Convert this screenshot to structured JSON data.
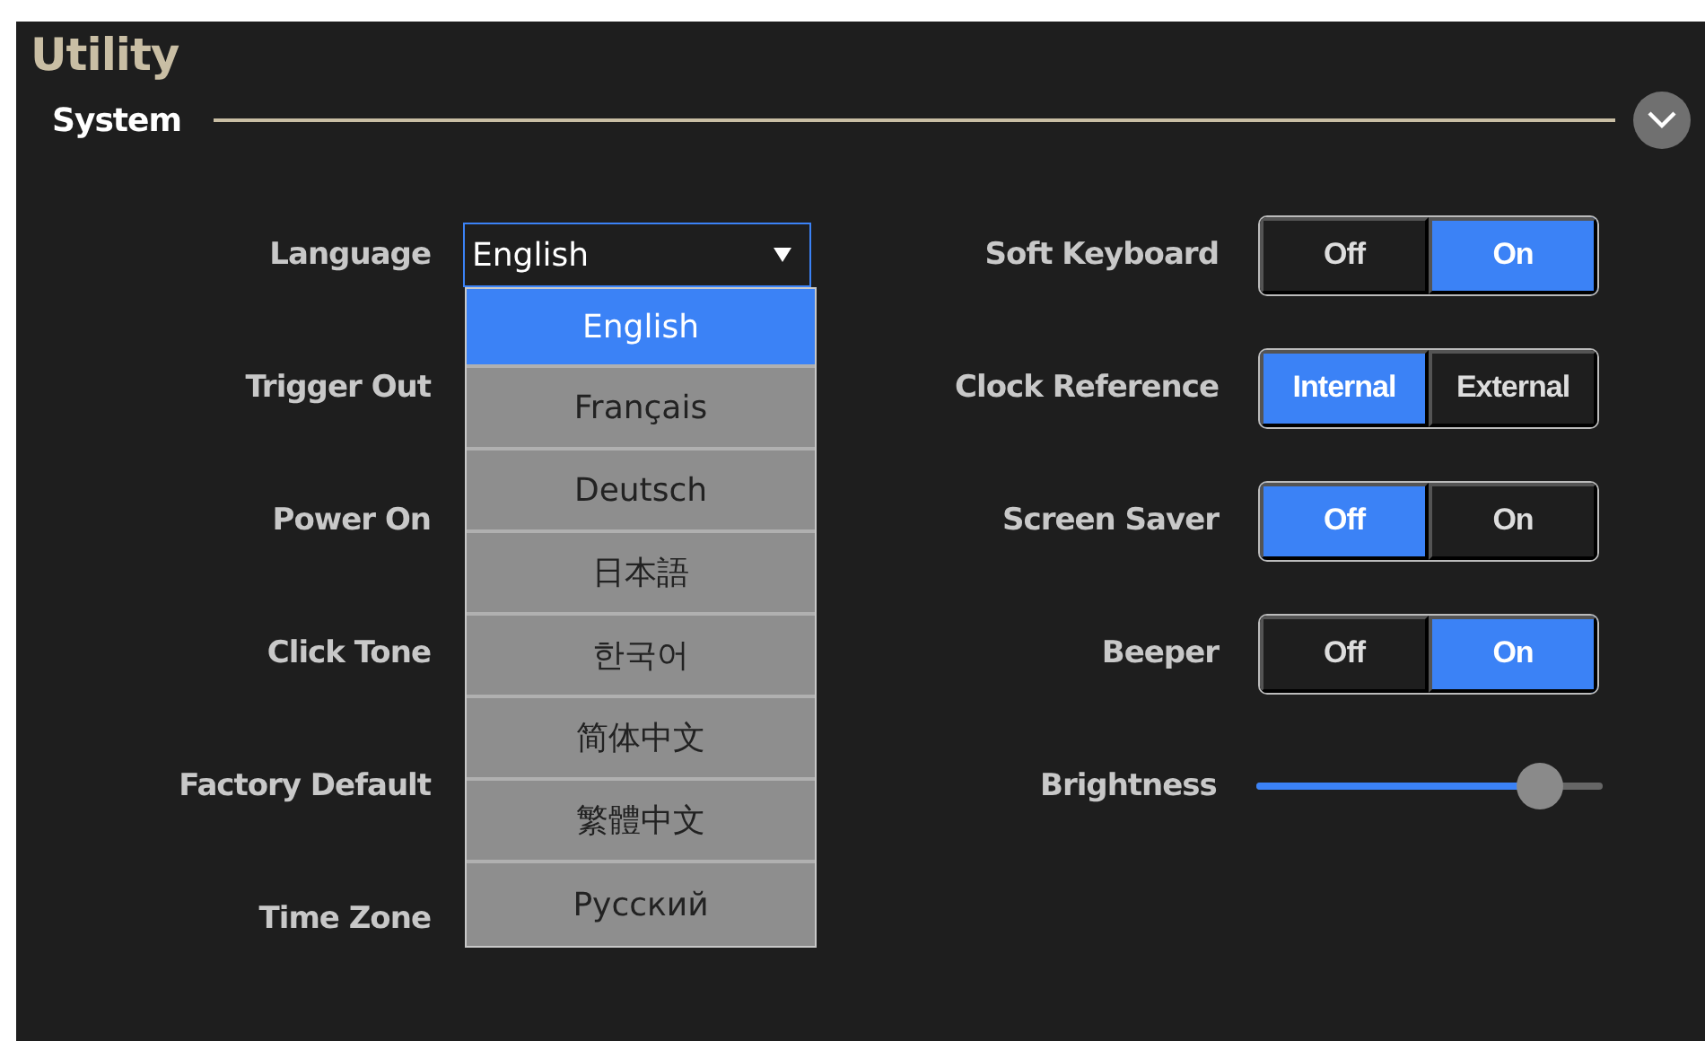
{
  "title": "Utility",
  "section": {
    "title": "System"
  },
  "left_settings": [
    {
      "label": "Language",
      "kind": "dropdown",
      "value": "English",
      "open": true,
      "options": [
        {
          "label": "English",
          "selected": true
        },
        {
          "label": "Français",
          "selected": false
        },
        {
          "label": "Deutsch",
          "selected": false
        },
        {
          "label": "日本語",
          "selected": false
        },
        {
          "label": "한국어",
          "selected": false
        },
        {
          "label": "简体中文",
          "selected": false
        },
        {
          "label": "繁體中文",
          "selected": false
        },
        {
          "label": "Русский",
          "selected": false
        }
      ]
    },
    {
      "label": "Trigger Out",
      "kind": "covered"
    },
    {
      "label": "Power On",
      "kind": "covered"
    },
    {
      "label": "Click Tone",
      "kind": "covered"
    },
    {
      "label": "Factory Default",
      "kind": "covered"
    },
    {
      "label": "Time Zone",
      "kind": "covered"
    }
  ],
  "right_settings": [
    {
      "label": "Soft Keyboard",
      "kind": "toggle",
      "options": [
        {
          "label": "Off",
          "selected": false
        },
        {
          "label": "On",
          "selected": true
        }
      ]
    },
    {
      "label": "Clock Reference",
      "kind": "toggle",
      "options": [
        {
          "label": "Internal",
          "selected": true
        },
        {
          "label": "External",
          "selected": false
        }
      ]
    },
    {
      "label": "Screen Saver",
      "kind": "toggle",
      "options": [
        {
          "label": "Off",
          "selected": true
        },
        {
          "label": "On",
          "selected": false
        }
      ]
    },
    {
      "label": "Beeper",
      "kind": "toggle",
      "options": [
        {
          "label": "Off",
          "selected": false
        },
        {
          "label": "On",
          "selected": true
        }
      ]
    },
    {
      "label": "Brightness",
      "kind": "slider",
      "level": 0.82
    }
  ]
}
